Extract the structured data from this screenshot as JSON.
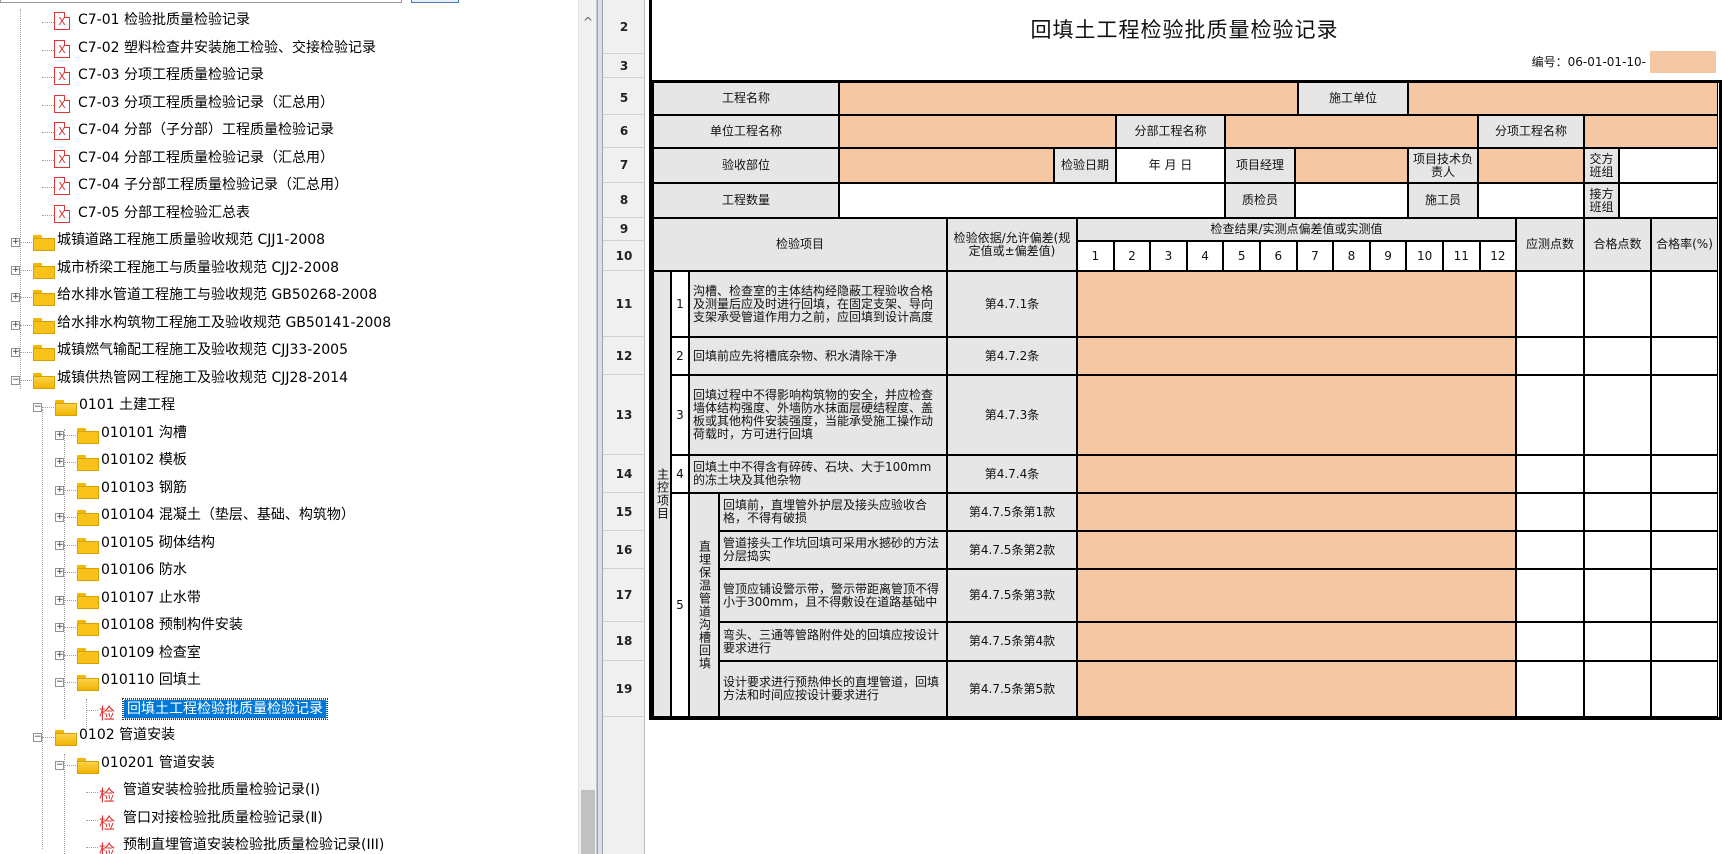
{
  "tree": {
    "items": [
      {
        "label": "C7-01 检验批质量检验记录",
        "icon": "xls-icon"
      },
      {
        "label": "C7-02 塑料检查井安装施工检验、交接检验记录",
        "icon": "xls-icon"
      },
      {
        "label": "C7-03 分项工程质量检验记录",
        "icon": "xls-icon"
      },
      {
        "label": "C7-03 分项工程质量检验记录（汇总用）",
        "icon": "xls-icon"
      },
      {
        "label": "C7-04 分部（子分部）工程质量检验记录",
        "icon": "xls-icon"
      },
      {
        "label": "C7-04 分部工程质量检验记录（汇总用）",
        "icon": "xls-icon"
      },
      {
        "label": "C7-04 子分部工程质量检验记录（汇总用）",
        "icon": "xls-icon"
      },
      {
        "label": "C7-05 分部工程检验汇总表",
        "icon": "xls-icon"
      },
      {
        "label": "城镇道路工程施工质量验收规范 CJJ1-2008",
        "icon": "folder-icon"
      },
      {
        "label": "城市桥梁工程施工与质量验收规范 CJJ2-2008",
        "icon": "folder-icon"
      },
      {
        "label": "给水排水管道工程施工与验收规范 GB50268-2008",
        "icon": "folder-icon"
      },
      {
        "label": "给水排水构筑物工程施工及验收规范 GB50141-2008",
        "icon": "folder-icon"
      },
      {
        "label": "城镇燃气输配工程施工及验收规范 CJJ33-2005",
        "icon": "folder-icon"
      },
      {
        "label": "城镇供热管网工程施工及验收规范 CJJ28-2014",
        "icon": "folder-open-icon"
      },
      {
        "label": "0101 土建工程",
        "icon": "folder-open-icon"
      },
      {
        "label": "010101 沟槽",
        "icon": "folder-icon"
      },
      {
        "label": "010102 模板",
        "icon": "folder-icon"
      },
      {
        "label": "010103 钢筋",
        "icon": "folder-icon"
      },
      {
        "label": "010104 混凝土（垫层、基础、构筑物）",
        "icon": "folder-icon"
      },
      {
        "label": "010105 砌体结构",
        "icon": "folder-icon"
      },
      {
        "label": "010106 防水",
        "icon": "folder-icon"
      },
      {
        "label": "010107 止水带",
        "icon": "folder-icon"
      },
      {
        "label": "010108 预制构件安装",
        "icon": "folder-icon"
      },
      {
        "label": "010109 检查室",
        "icon": "folder-icon"
      },
      {
        "label": "010110 回填土",
        "icon": "folder-open-icon"
      },
      {
        "label": "回填土工程检验批质量检验记录",
        "icon": "check-icon"
      },
      {
        "label": "0102 管道安装",
        "icon": "folder-open-icon"
      },
      {
        "label": "010201 管道安装",
        "icon": "folder-open-icon"
      },
      {
        "label": "管道安装检验批质量检验记录(Ⅰ)",
        "icon": "check-icon"
      },
      {
        "label": "管口对接检验批质量检验记录(Ⅱ)",
        "icon": "check-icon"
      },
      {
        "label": "预制直埋管道安装检验批质量检验记录(III)",
        "icon": "check-icon"
      }
    ],
    "icon_glyphs": {
      "xls": "X",
      "check": "检",
      "expand": "+",
      "collapse": "−",
      "scroll_up": "^"
    }
  },
  "sheet": {
    "row_numbers": [
      "2",
      "3",
      "5",
      "6",
      "7",
      "8",
      "9",
      "10",
      "11",
      "12",
      "13",
      "14",
      "15",
      "16",
      "17",
      "18",
      "19"
    ],
    "title": "回填土工程检验批质量检验记录",
    "serial_label": "编号：06-01-01-10-",
    "labels": {
      "project_name": "工程名称",
      "construction_unit": "施工单位",
      "unit_project_name": "单位工程名称",
      "division_project_name": "分部工程名称",
      "subitem_project_name": "分项工程名称",
      "acceptance_part": "验收部位",
      "inspection_date": "检验日期",
      "date_placeholder": "年   月   日",
      "project_manager": "项目经理",
      "tech_lead": "项目技术负责人",
      "handover_team": "交方班组",
      "quantity": "工程数量",
      "inspector": "质检员",
      "constructor": "施工员",
      "receiving_team": "接方班组",
      "inspection_item": "检验项目",
      "basis": "检验依据/允许偏差(规定值或±偏差值)",
      "results_header": "检查结果/实测点偏差值或实测值",
      "should_measure": "应测点数",
      "qualified_points": "合格点数",
      "pass_rate": "合格率(%)",
      "main_control": "主控项目",
      "direct_buried": "直埋保温管道沟槽回填"
    },
    "point_numbers": [
      "1",
      "2",
      "3",
      "4",
      "5",
      "6",
      "7",
      "8",
      "9",
      "10",
      "11",
      "12"
    ],
    "items": [
      {
        "no": "1",
        "text": "沟槽、检查室的主体结构经隐蔽工程验收合格及测量后应及时进行回填，在固定支架、导向支架承受管道作用力之前，应回填到设计高度",
        "basis": "第4.7.1条"
      },
      {
        "no": "2",
        "text": "回填前应先将槽底杂物、积水清除干净",
        "basis": "第4.7.2条"
      },
      {
        "no": "3",
        "text": "回填过程中不得影响构筑物的安全，并应检查墙体结构强度、外墙防水抹面层硬结程度、盖板或其他构件安装强度，当能承受施工操作动荷载时，方可进行回填",
        "basis": "第4.7.3条"
      },
      {
        "no": "4",
        "text": "回填土中不得含有碎砖、石块、大于100mm的冻土块及其他杂物",
        "basis": "第4.7.4条"
      }
    ],
    "item5_no": "5",
    "item5_sub": [
      {
        "text": "回填前，直埋管外护层及接头应验收合格，不得有破损",
        "basis": "第4.7.5条第1款"
      },
      {
        "text": "管道接头工作坑回填可采用水撼砂的方法分层捣实",
        "basis": "第4.7.5条第2款"
      },
      {
        "text": "管顶应铺设警示带，警示带距离管顶不得小于300mm，且不得敷设在道路基础中",
        "basis": "第4.7.5条第3款"
      },
      {
        "text": "弯头、三通等管路附件处的回填应按设计要求进行",
        "basis": "第4.7.5条第4款"
      },
      {
        "text": "设计要求进行预热伸长的直埋管道，回填方法和时间应按设计要求进行",
        "basis": "第4.7.5条第5款"
      }
    ],
    "colors": {
      "peach": "#f5c8a3",
      "gray": "#e6e6e6",
      "selection": "#0078d7"
    }
  }
}
